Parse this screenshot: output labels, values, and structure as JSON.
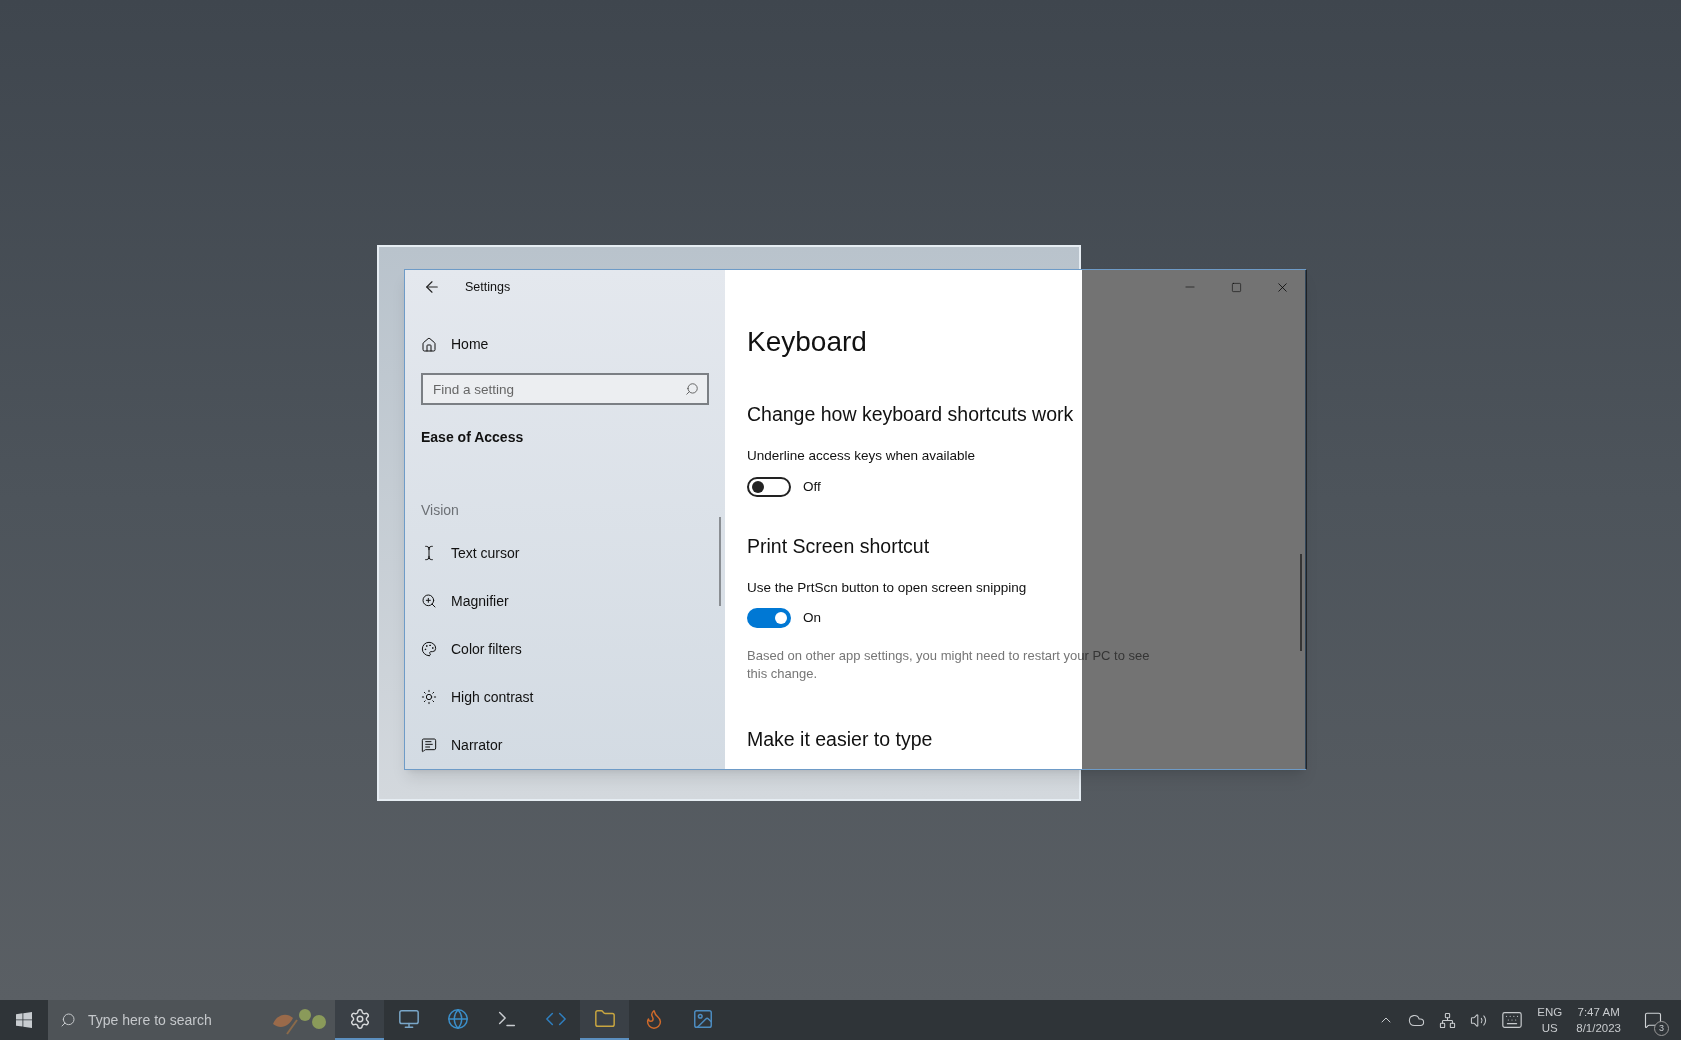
{
  "window": {
    "title": "Settings"
  },
  "sidebar": {
    "home": "Home",
    "search": {
      "placeholder": "Find a setting"
    },
    "section": "Ease of Access",
    "group": "Vision",
    "items": [
      {
        "label": "Text cursor"
      },
      {
        "label": "Magnifier"
      },
      {
        "label": "Color filters"
      },
      {
        "label": "High contrast"
      },
      {
        "label": "Narrator"
      }
    ]
  },
  "content": {
    "title": "Keyboard",
    "sections": [
      {
        "heading": "Change how keyboard shortcuts work",
        "settings": [
          {
            "label": "Underline access keys when available",
            "on": false,
            "state_text": "Off"
          }
        ]
      },
      {
        "heading": "Print Screen shortcut",
        "settings": [
          {
            "label": "Use the PrtScn button to open screen snipping",
            "on": true,
            "state_text": "On",
            "note": "Based on other app settings, you might need to restart your PC to see this change."
          }
        ]
      },
      {
        "heading": "Make it easier to type"
      }
    ]
  },
  "taskbar": {
    "search": {
      "placeholder": "Type here to search"
    },
    "apps": [
      {
        "running": true
      },
      {
        "running": false
      },
      {
        "running": false
      },
      {
        "running": false
      },
      {
        "running": false
      },
      {
        "running": true
      },
      {
        "running": false
      },
      {
        "running": false
      }
    ],
    "tray": {
      "language": "ENG",
      "region": "US",
      "time": "7:47 AM",
      "date": "8/1/2023",
      "notifications": "3"
    }
  }
}
